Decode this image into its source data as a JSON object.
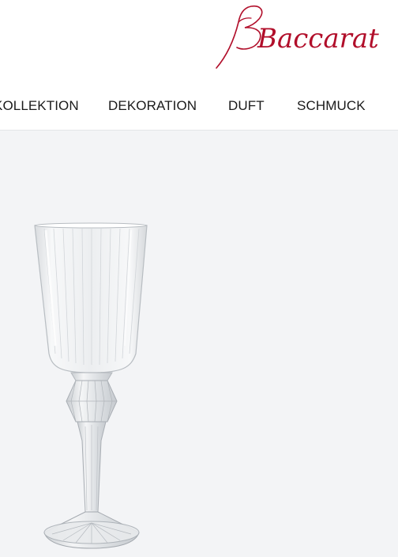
{
  "brand": {
    "name": "Baccarat",
    "color": "#b10e2a"
  },
  "nav": {
    "items": [
      {
        "label": "KOLLEKTION"
      },
      {
        "label": "DEKORATION"
      },
      {
        "label": "DUFT"
      },
      {
        "label": "SCHMUCK"
      }
    ]
  },
  "product": {
    "image_subject": "crystal-glass-icon"
  },
  "colors": {
    "header_bg": "#ffffff",
    "content_bg": "#f3f4f6",
    "text": "#1a1a1a"
  }
}
